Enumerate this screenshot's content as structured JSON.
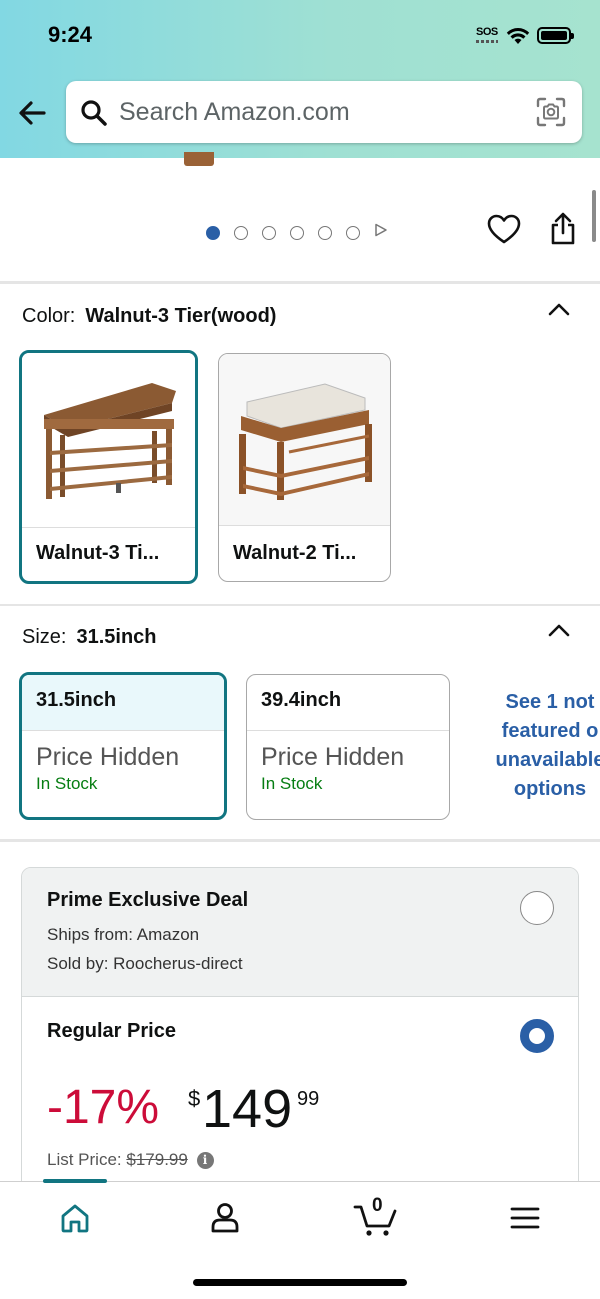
{
  "status_bar": {
    "time": "9:24",
    "sos": "SOS"
  },
  "search": {
    "placeholder": "Search Amazon.com"
  },
  "carousel": {
    "dot_count": 6,
    "active_index": 0
  },
  "color_selector": {
    "label": "Color:",
    "selected_value": "Walnut-3 Tier(wood)",
    "options": [
      {
        "label": "Walnut-3 Ti...",
        "selected": true
      },
      {
        "label": "Walnut-2 Ti...",
        "selected": false
      }
    ]
  },
  "size_selector": {
    "label": "Size:",
    "selected_value": "31.5inch",
    "options": [
      {
        "size": "31.5inch",
        "price": "Price Hidden",
        "stock": "In Stock",
        "selected": true
      },
      {
        "size": "39.4inch",
        "price": "Price Hidden",
        "stock": "In Stock",
        "selected": false
      }
    ],
    "see_more_lines": [
      "See 1 not",
      "featured o",
      "unavailable",
      "options"
    ]
  },
  "offers": {
    "prime": {
      "title": "Prime Exclusive Deal",
      "ships_from": "Ships from: Amazon",
      "sold_by": "Sold by: Roocherus-direct",
      "selected": false
    },
    "regular": {
      "title": "Regular Price",
      "discount": "-17%",
      "currency": "$",
      "price_whole": "149",
      "price_fraction": "99",
      "list_price_label": "List Price:",
      "list_price": "$179.99",
      "selected": true
    }
  },
  "bottom_nav": {
    "cart_count": "0",
    "active": "home"
  },
  "colors": {
    "teal": "#117581",
    "blue": "#2a5fa6",
    "deal_red": "#cc0c39",
    "in_stock_green": "#067d12"
  }
}
